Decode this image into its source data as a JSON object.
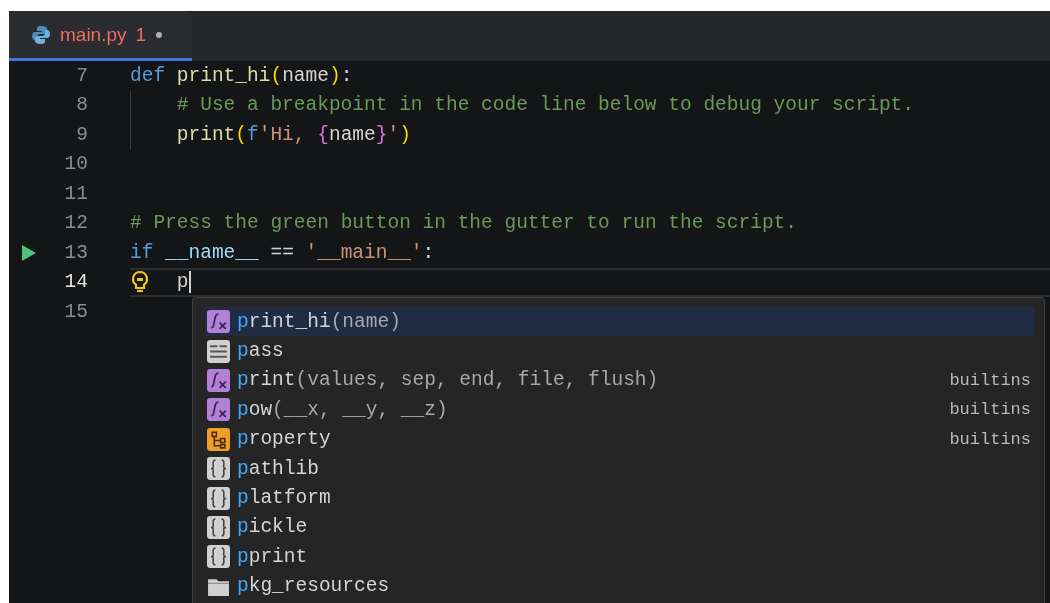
{
  "tabs": [
    {
      "label": "main.py",
      "problems": "1",
      "modified": true,
      "has_error": true,
      "selected": true
    }
  ],
  "lines": [
    {
      "number": "7",
      "indented": false,
      "current": false,
      "run": false,
      "lightbulb": false,
      "tokens": [
        {
          "text": "def ",
          "kind": "keyword"
        },
        {
          "text": "print_hi",
          "kind": "function"
        },
        {
          "text": "(",
          "kind": "bracket1"
        },
        {
          "text": "name",
          "kind": "plain"
        },
        {
          "text": ")",
          "kind": "bracket1"
        },
        {
          "text": ":",
          "kind": "plain"
        }
      ]
    },
    {
      "number": "8",
      "indented": true,
      "current": false,
      "run": false,
      "lightbulb": false,
      "tokens": [
        {
          "text": "# Use a breakpoint in the code line below to debug your script.",
          "kind": "comment"
        }
      ]
    },
    {
      "number": "9",
      "indented": true,
      "current": false,
      "run": false,
      "lightbulb": false,
      "tokens": [
        {
          "text": "print",
          "kind": "function"
        },
        {
          "text": "(",
          "kind": "bracket1"
        },
        {
          "text": "f",
          "kind": "keyword"
        },
        {
          "text": "'Hi, ",
          "kind": "string"
        },
        {
          "text": "{",
          "kind": "bracket2"
        },
        {
          "text": "name",
          "kind": "plain"
        },
        {
          "text": "}",
          "kind": "bracket2"
        },
        {
          "text": "'",
          "kind": "string"
        },
        {
          "text": ")",
          "kind": "bracket1"
        }
      ]
    },
    {
      "number": "10",
      "indented": false,
      "current": false,
      "run": false,
      "lightbulb": false
    },
    {
      "number": "11",
      "indented": false,
      "current": false,
      "run": false,
      "lightbulb": false
    },
    {
      "number": "12",
      "indented": false,
      "current": false,
      "run": false,
      "lightbulb": false,
      "tokens": [
        {
          "text": "# Press the green button in the gutter to run the script.",
          "kind": "comment"
        }
      ]
    },
    {
      "number": "13",
      "indented": false,
      "current": false,
      "run": true,
      "lightbulb": false,
      "tokens": [
        {
          "text": "if ",
          "kind": "keyword"
        },
        {
          "text": "__name__",
          "kind": "variable"
        },
        {
          "text": " == ",
          "kind": "plain"
        },
        {
          "text": "'__main__'",
          "kind": "string"
        },
        {
          "text": ":",
          "kind": "plain"
        }
      ]
    },
    {
      "number": "14",
      "indented": true,
      "current": true,
      "run": false,
      "lightbulb": true,
      "tokens": [
        {
          "text": "p",
          "kind": "plain"
        }
      ]
    },
    {
      "number": "15",
      "indented": false,
      "current": false,
      "run": false,
      "lightbulb": false
    }
  ],
  "completions": [
    {
      "kind": "function",
      "match": "p",
      "rest": "rint_hi",
      "params": "(name)",
      "selected": true
    },
    {
      "kind": "keyword",
      "match": "p",
      "rest": "ass",
      "selected": false
    },
    {
      "kind": "function",
      "match": "p",
      "rest": "rint",
      "params": "(values, sep, end, file, flush)",
      "detail": "builtins",
      "selected": false
    },
    {
      "kind": "function",
      "match": "p",
      "rest": "ow",
      "params": "(__x, __y, __z)",
      "detail": "builtins",
      "selected": false
    },
    {
      "kind": "class",
      "match": "p",
      "rest": "roperty",
      "detail": "builtins",
      "selected": false
    },
    {
      "kind": "module",
      "match": "p",
      "rest": "athlib",
      "selected": false
    },
    {
      "kind": "module",
      "match": "p",
      "rest": "latform",
      "selected": false
    },
    {
      "kind": "module",
      "match": "p",
      "rest": "ickle",
      "selected": false
    },
    {
      "kind": "module",
      "match": "p",
      "rest": "print",
      "selected": false
    },
    {
      "kind": "folder",
      "match": "p",
      "rest": "kg_resources",
      "selected": false
    }
  ]
}
